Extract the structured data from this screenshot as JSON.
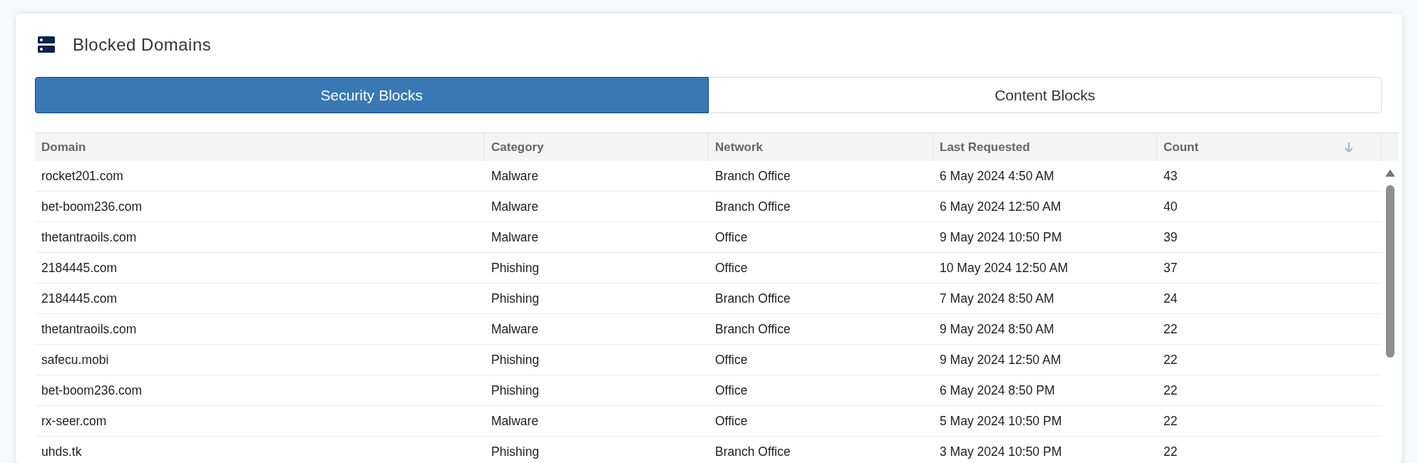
{
  "title": "Blocked Domains",
  "tabs": [
    {
      "label": "Security Blocks",
      "selected": true
    },
    {
      "label": "Content Blocks",
      "selected": false
    }
  ],
  "table": {
    "columns": [
      {
        "label": "Domain",
        "sorted": false
      },
      {
        "label": "Category",
        "sorted": false
      },
      {
        "label": "Network",
        "sorted": false
      },
      {
        "label": "Last Requested",
        "sorted": false
      },
      {
        "label": "Count",
        "sorted": true
      }
    ],
    "rows": [
      [
        "rocket201.com",
        "Malware",
        "Branch Office",
        "6 May 2024 4:50 AM",
        "43"
      ],
      [
        "bet-boom236.com",
        "Malware",
        "Branch Office",
        "6 May 2024 12:50 AM",
        "40"
      ],
      [
        "thetantraoils.com",
        "Malware",
        "Office",
        "9 May 2024 10:50 PM",
        "39"
      ],
      [
        "2184445.com",
        "Phishing",
        "Office",
        "10 May 2024 12:50 AM",
        "37"
      ],
      [
        "2184445.com",
        "Phishing",
        "Branch Office",
        "7 May 2024 8:50 AM",
        "24"
      ],
      [
        "thetantraoils.com",
        "Malware",
        "Branch Office",
        "9 May 2024 8:50 AM",
        "22"
      ],
      [
        "safecu.mobi",
        "Phishing",
        "Office",
        "9 May 2024 12:50 AM",
        "22"
      ],
      [
        "bet-boom236.com",
        "Phishing",
        "Office",
        "6 May 2024 8:50 PM",
        "22"
      ],
      [
        "rx-seer.com",
        "Malware",
        "Office",
        "5 May 2024 10:50 PM",
        "22"
      ],
      [
        "uhds.tk",
        "Phishing",
        "Branch Office",
        "3 May 2024 10:50 PM",
        "22"
      ]
    ]
  }
}
